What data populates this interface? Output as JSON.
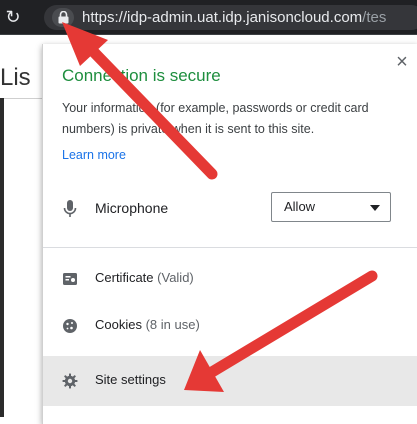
{
  "browser": {
    "url_main": "https://idp-admin.uat.idp.janisoncloud.com",
    "url_faded": "/tes"
  },
  "page": {
    "title_partial": "Lis"
  },
  "popup": {
    "title": "Connection is secure",
    "description": "Your information (for example, passwords or credit card numbers) is private when it is sent to this site.",
    "learn_more": "Learn more",
    "close_glyph": "×",
    "permission": {
      "label": "Microphone",
      "selected": "Allow",
      "icon": "microphone-icon"
    },
    "items": [
      {
        "label": "Certificate",
        "detail": "(Valid)",
        "icon": "certificate-icon"
      },
      {
        "label": "Cookies",
        "detail": "(8 in use)",
        "icon": "cookie-icon"
      },
      {
        "label": "Site settings",
        "detail": "",
        "icon": "gear-icon"
      }
    ]
  },
  "annotations": {
    "arrow_color": "#e53935",
    "count": 2
  },
  "colors": {
    "secure_green": "#1e8e3e",
    "link_blue": "#1a73e8",
    "highlight_row": "#e8e8e8",
    "chrome_dark": "#202124"
  }
}
